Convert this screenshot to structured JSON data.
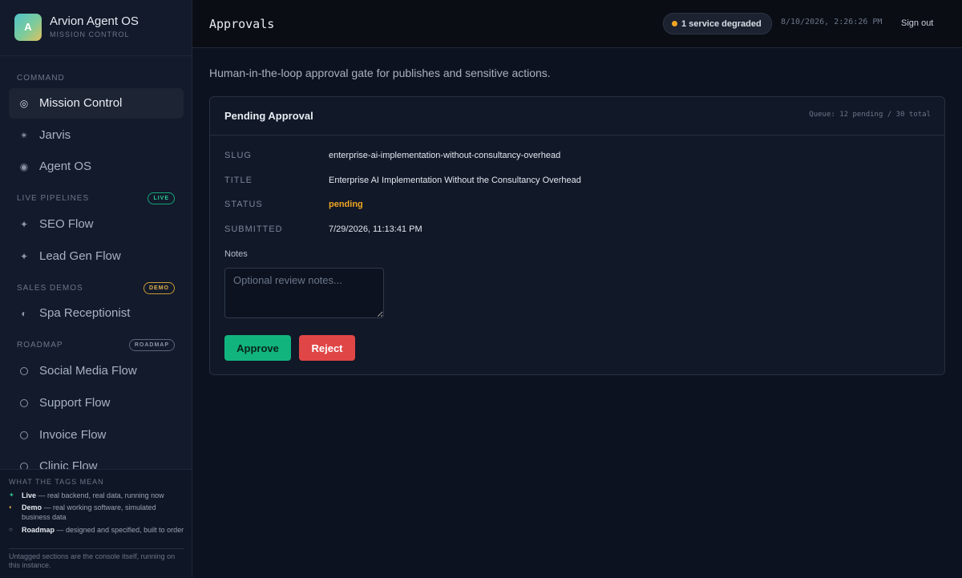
{
  "brand": {
    "logo_letter": "A",
    "name": "Arvion Agent OS",
    "subtitle": "MISSION CONTROL"
  },
  "sidebar": {
    "sections": [
      {
        "title": "COMMAND",
        "tag": ""
      },
      {
        "title": "LIVE PIPELINES",
        "tag": "LIVE"
      },
      {
        "title": "SALES DEMOS",
        "tag": "DEMO"
      },
      {
        "title": "ROADMAP",
        "tag": "ROADMAP"
      }
    ],
    "items": [
      {
        "label": "Mission Control",
        "icon": "◎",
        "icon_name": "target-icon",
        "active": true
      },
      {
        "label": "Jarvis",
        "icon": "✴",
        "icon_name": "sparkle-icon"
      },
      {
        "label": "Agent OS",
        "icon": "◉",
        "icon_name": "radio-icon"
      },
      {
        "label": "SEO Flow",
        "icon": "✦",
        "icon_name": "star-icon"
      },
      {
        "label": "Lead Gen Flow",
        "icon": "✦",
        "icon_name": "star-icon"
      },
      {
        "label": "Spa Receptionist",
        "icon": "◐",
        "icon_name": "half-circle-icon"
      },
      {
        "label": "Social Media Flow",
        "icon_name": "circle-outline-icon"
      },
      {
        "label": "Support Flow",
        "icon_name": "circle-outline-icon"
      },
      {
        "label": "Invoice Flow",
        "icon_name": "circle-outline-icon"
      },
      {
        "label": "Clinic Flow",
        "icon_name": "circle-outline-icon"
      }
    ]
  },
  "legend": {
    "title": "WHAT THE TAGS MEAN",
    "rows": [
      {
        "glyph": "✦",
        "term": "Live",
        "desc": " — real backend, real data, running now",
        "color": "#2ec795"
      },
      {
        "glyph": "◐",
        "term": "Demo",
        "desc": " — real working software, simulated business data",
        "color": "#e0b04a"
      },
      {
        "glyph": "○",
        "term": "Roadmap",
        "desc": " — designed and specified, built to order",
        "color": "#8a95a6"
      }
    ],
    "footer": "Untagged sections are the console itself, running on this instance."
  },
  "topbar": {
    "title": "Approvals",
    "status": "1 service degraded",
    "status_color": "#f0a623",
    "datetime": "8/10/2026, 2:26:26 PM",
    "signout": "Sign out"
  },
  "main": {
    "description": "Human-in-the-loop approval gate for publishes and sensitive actions.",
    "card": {
      "title": "Pending Approval",
      "queue": "Queue: 12 pending / 30 total",
      "fields": [
        {
          "label": "SLUG",
          "value": "enterprise-ai-implementation-without-consultancy-overhead"
        },
        {
          "label": "TITLE",
          "value": "Enterprise AI Implementation Without the Consultancy Overhead"
        },
        {
          "label": "STATUS",
          "value": "pending"
        },
        {
          "label": "SUBMITTED",
          "value": "7/29/2026, 11:13:41 PM"
        }
      ],
      "notes_label": "Notes",
      "notes_placeholder": "Optional review notes...",
      "notes_value": "",
      "approve": "Approve",
      "reject": "Reject"
    }
  }
}
